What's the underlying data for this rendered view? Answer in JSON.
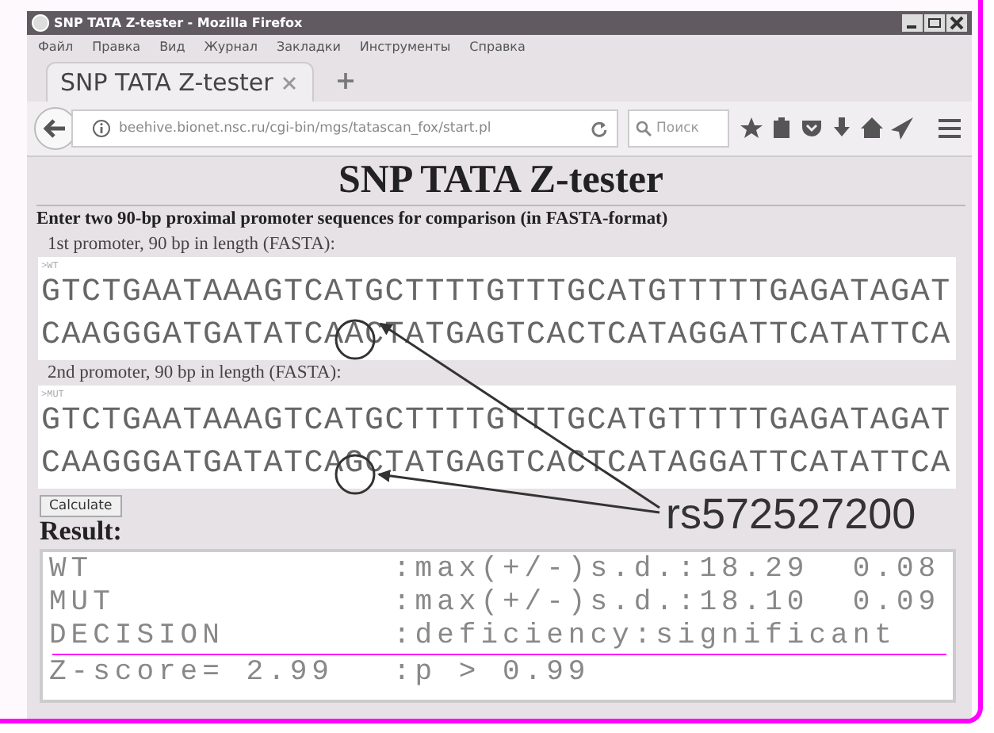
{
  "window": {
    "title": "SNP TATA Z-tester - Mozilla Firefox"
  },
  "menu": [
    "Файл",
    "Правка",
    "Вид",
    "Журнал",
    "Закладки",
    "Инструменты",
    "Справка"
  ],
  "tabs": [
    {
      "label": "SNP TATA Z-tester",
      "selected": true
    }
  ],
  "address_bar": {
    "url": "beehive.bionet.nsc.ru/cgi-bin/mgs/tatascan_fox/start.pl"
  },
  "search": {
    "placeholder": "Поиск"
  },
  "page": {
    "heading": "SNP TATA Z-tester",
    "instruction": "Enter two 90-bp proximal promoter sequences for comparison (in FASTA-format)",
    "sequences": [
      {
        "label": "1st promoter, 90 bp in length (FASTA):",
        "header": ">WT",
        "lines": [
          "GTCTGAATAAAGTCATGCTTTTGTTTGCATGTTTTTGAGATAGAT",
          "CAAGGGATGATATCAACTATGAGTCACTCATAGGATTCATATTCA"
        ]
      },
      {
        "label": "2nd promoter, 90 bp in length (FASTA):",
        "header": ">MUT",
        "lines": [
          "GTCTGAATAAAGTCATGCTTTTGTTTGCATGTTTTTGAGATAGAT",
          "CAAGGGATGATATCAGCTATGAGTCACTCATAGGATTCATATTCA"
        ]
      }
    ],
    "button": "Calculate",
    "result_title": "Result:",
    "results": [
      {
        "label": "WT",
        "value": ":max(+/-)s.d.:18.29  0.08"
      },
      {
        "label": "MUT",
        "value": ":max(+/-)s.d.:18.10  0.09"
      },
      {
        "label": "DECISION",
        "value": ":deficiency:significant"
      },
      {
        "label": "Z-score= 2.99",
        "value": ":p > 0.99"
      }
    ]
  },
  "annotation": {
    "label": "rs572527200"
  }
}
